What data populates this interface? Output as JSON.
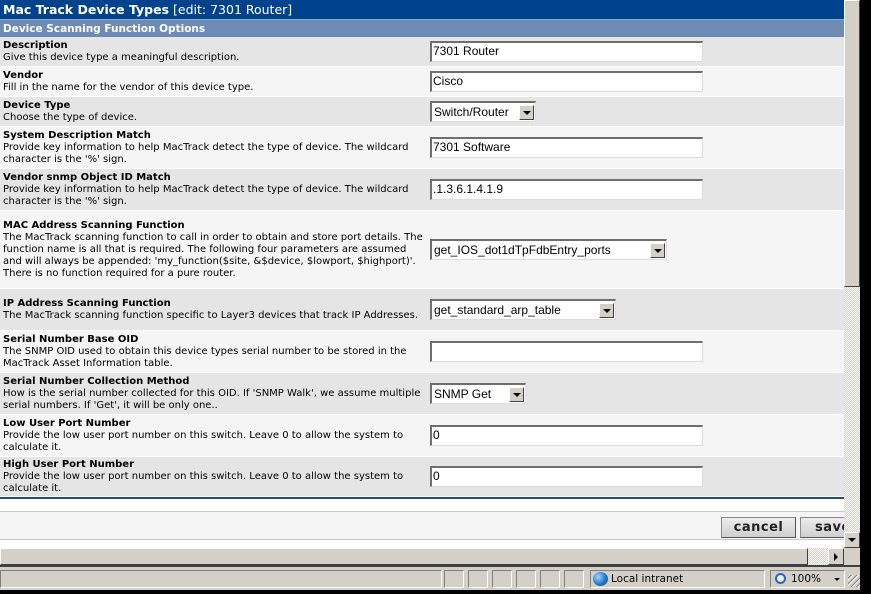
{
  "page": {
    "title_main": "Mac Track Device Types",
    "title_sub": " [edit: 7301 Router]",
    "section_header": "Device Scanning Function Options"
  },
  "form": {
    "rows": [
      {
        "title": "Description",
        "desc": "Give this device type a meaningful description.",
        "type": "text",
        "value": "7301 Router"
      },
      {
        "title": "Vendor",
        "desc": "Fill in the name for the vendor of this device type.",
        "type": "text",
        "value": "Cisco"
      },
      {
        "title": "Device Type",
        "desc": "Choose the type of device.",
        "type": "select",
        "value": "Switch/Router"
      },
      {
        "title": "System Description Match",
        "desc": "Provide key information to help MacTrack detect the type of device. The wildcard character is the '%' sign.",
        "type": "text",
        "value": "7301 Software"
      },
      {
        "title": "Vendor snmp Object ID Match",
        "desc": "Provide key information to help MacTrack detect the type of device. The wildcard character is the '%' sign.",
        "type": "text",
        "value": ".1.3.6.1.4.1.9"
      },
      {
        "title": "MAC Address Scanning Function",
        "desc": "The MacTrack scanning function to call in order to obtain and store port details. The function name is all that is required. The following four parameters are assumed and will always be appended: 'my_function($site, &$device, $lowport, $highport)'. There is no function required for a pure router.",
        "type": "select",
        "value": "get_IOS_dot1dTpFdbEntry_ports"
      },
      {
        "title": "IP Address Scanning Function",
        "desc": "The MacTrack scanning function specific to Layer3 devices that track IP Addresses.",
        "type": "select",
        "value": "get_standard_arp_table"
      },
      {
        "title": "Serial Number Base OID",
        "desc": "The SNMP OID used to obtain this device types serial number to be stored in the MacTrack Asset Information table.",
        "type": "text",
        "value": ""
      },
      {
        "title": "Serial Number Collection Method",
        "desc": "How is the serial number collected for this OID. If 'SNMP Walk', we assume multiple serial numbers. If 'Get', it will be only one..",
        "type": "select",
        "value": "SNMP Get"
      },
      {
        "title": "Low User Port Number",
        "desc": "Provide the low user port number on this switch. Leave 0 to allow the system to calculate it.",
        "type": "text",
        "value": "0"
      },
      {
        "title": "High User Port Number",
        "desc": "Provide the low user port number on this switch. Leave 0 to allow the system to calculate it.",
        "type": "text",
        "value": "0"
      }
    ]
  },
  "buttons": {
    "cancel_label": "cancel",
    "save_label": "save"
  },
  "statusbar": {
    "zone_label": "Local intranet",
    "zone_icon": "globe-icon",
    "zoom_level": "100%",
    "zoom_icon": "magnifier-icon"
  }
}
